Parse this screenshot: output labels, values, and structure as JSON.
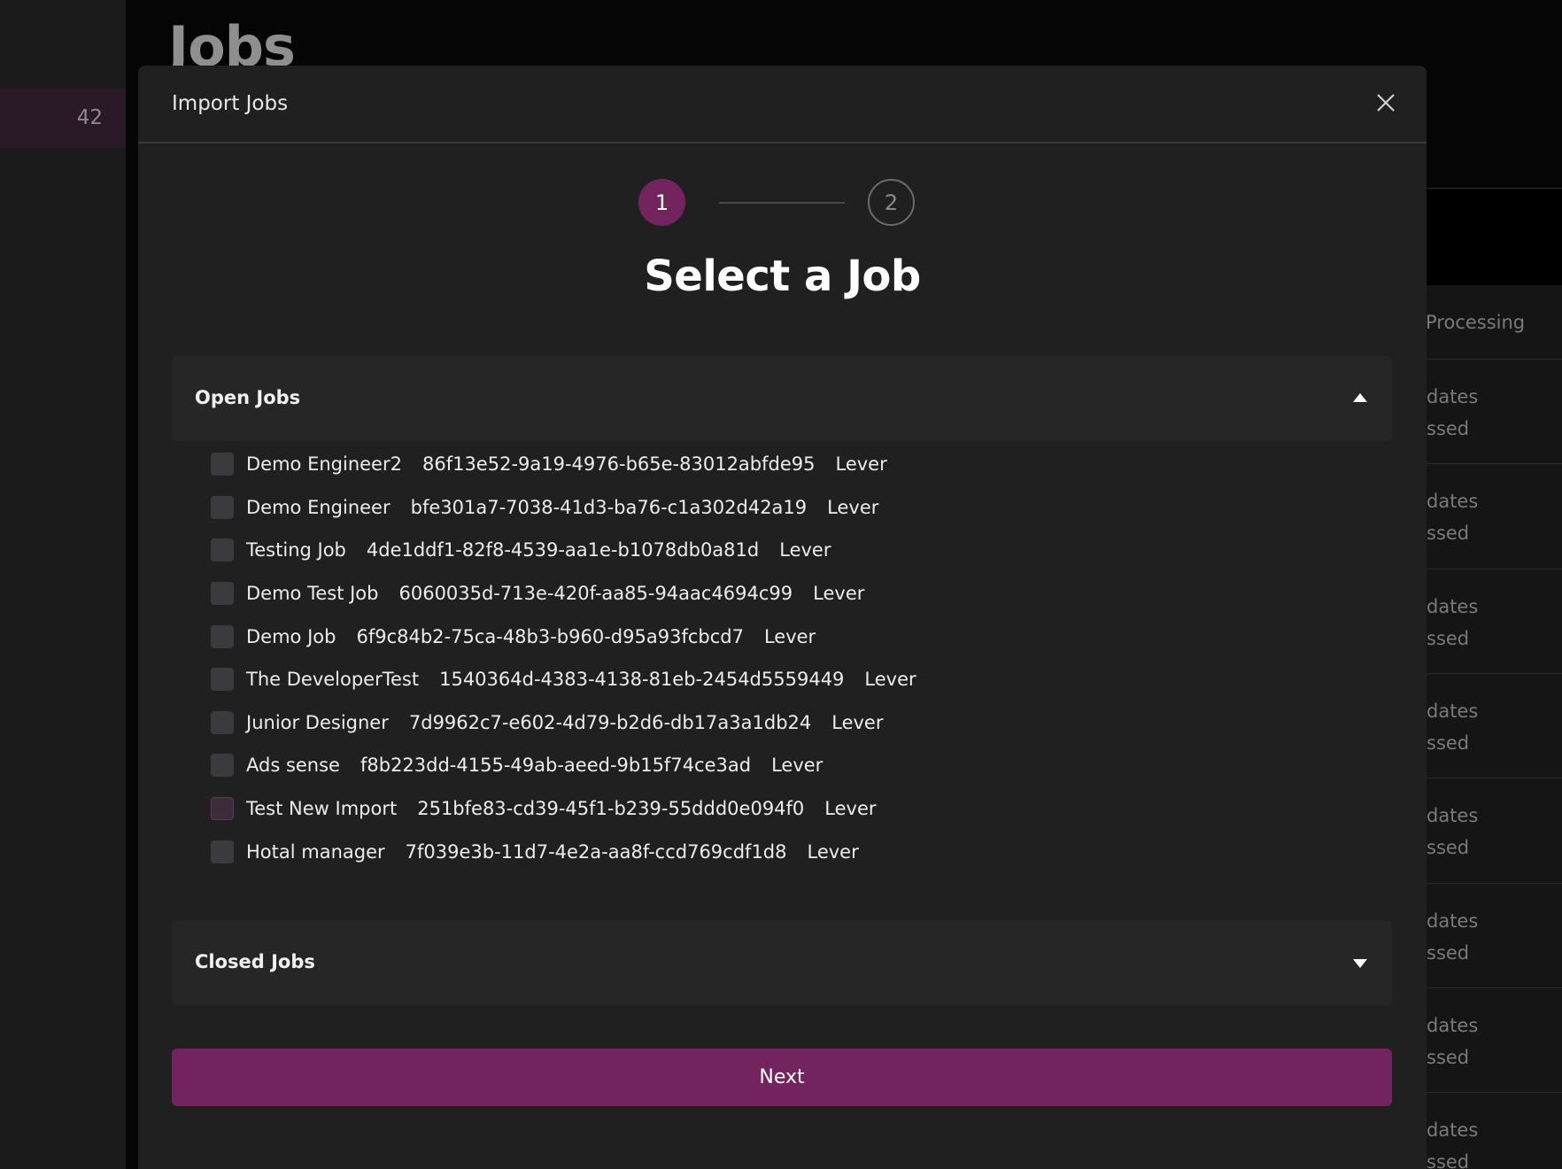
{
  "background": {
    "page_title": "Jobs",
    "sidebar_count": "42",
    "column_header": "Processing",
    "row_line1": "dates",
    "row_line2": "ssed"
  },
  "modal": {
    "title": "Import Jobs",
    "steps": [
      "1",
      "2"
    ],
    "heading": "Select a Job",
    "open_section_title": "Open Jobs",
    "closed_section_title": "Closed Jobs",
    "next_label": "Next",
    "jobs": [
      {
        "name": "Demo Engineer2",
        "id": "86f13e52-9a19-4976-b65e-83012abfde95",
        "source": "Lever"
      },
      {
        "name": "Demo Engineer",
        "id": "bfe301a7-7038-41d3-ba76-c1a302d42a19",
        "source": "Lever"
      },
      {
        "name": "Testing Job",
        "id": "4de1ddf1-82f8-4539-aa1e-b1078db0a81d",
        "source": "Lever"
      },
      {
        "name": "Demo Test Job",
        "id": "6060035d-713e-420f-aa85-94aac4694c99",
        "source": "Lever"
      },
      {
        "name": "Demo Job",
        "id": "6f9c84b2-75ca-48b3-b960-d95a93fcbcd7",
        "source": "Lever"
      },
      {
        "name": "The DeveloperTest",
        "id": "1540364d-4383-4138-81eb-2454d5559449",
        "source": "Lever"
      },
      {
        "name": "Junior Designer",
        "id": "7d9962c7-e602-4d79-b2d6-db17a3a1db24",
        "source": "Lever"
      },
      {
        "name": "Ads sense",
        "id": "f8b223dd-4155-49ab-aeed-9b15f74ce3ad",
        "source": "Lever"
      },
      {
        "name": "Test New Import",
        "id": "251bfe83-cd39-45f1-b239-55ddd0e094f0",
        "source": "Lever"
      },
      {
        "name": "Hotal manager",
        "id": "7f039e3b-11d7-4e2a-aa8f-ccd769cdf1d8",
        "source": "Lever"
      }
    ]
  },
  "colors": {
    "accent": "#73245f",
    "modal_bg": "#202020"
  }
}
